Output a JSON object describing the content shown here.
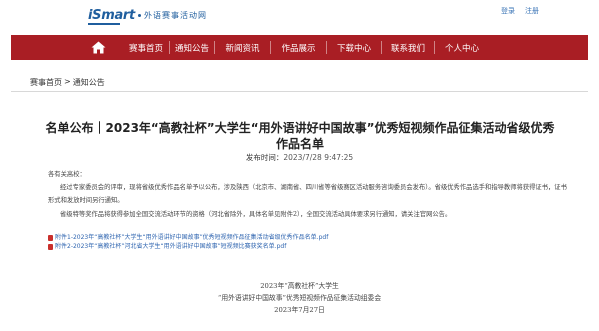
{
  "header": {
    "logo_word": "iSmart",
    "logo_cn": "外语赛事活动网",
    "top_links": [
      "登录",
      "注册"
    ]
  },
  "nav": {
    "items": [
      "赛事首页",
      "通知公告",
      "新闻资讯",
      "作品展示",
      "下载中心",
      "联系我们",
      "个人中心"
    ]
  },
  "breadcrumb": {
    "home": "赛事首页",
    "separator": ">",
    "current": "通知公告"
  },
  "article": {
    "title": "名单公布｜2023年“高教社杯”大学生“用外语讲好中国故事”优秀短视频作品征集活动省级优秀作品名单",
    "publish_label": "发布时间：",
    "publish_time": "2023/7/28 9:47:25",
    "paragraphs": [
      "各有关高校：",
      "经过专家委员会的评审，现将省级优秀作品名单予以公布，涉及陕西（北京市、湖南省、四川省等省级赛区活动服务咨询委员会发布）。省级优秀作品选手和指导教师将获得证书，证书形式和发放时间另行通知。",
      "省级特等奖作品将获得参加全国交流活动环节的资格（河北省除外，具体名单见附件2），全国交流活动具体要求另行通知，请关注官网公告。"
    ],
    "attachments": [
      "附件1-2023年“高教社杯”大学生“用外语讲好中国故事”优秀短视频作品征集活动省级优秀作品名单.pdf",
      "附件2-2023年“高教社杯”河北省大学生“用外语讲好中国故事”短视频比赛获奖名单.pdf"
    ],
    "signature": [
      "2023年“高教社杯”大学生",
      "“用外语讲好中国故事”优秀短视频作品征集活动组委会",
      "2023年7月27日"
    ]
  },
  "colors": {
    "nav_bg": "#a91e24",
    "logo_blue": "#1f5e9e",
    "link_blue": "#2f65b0"
  }
}
